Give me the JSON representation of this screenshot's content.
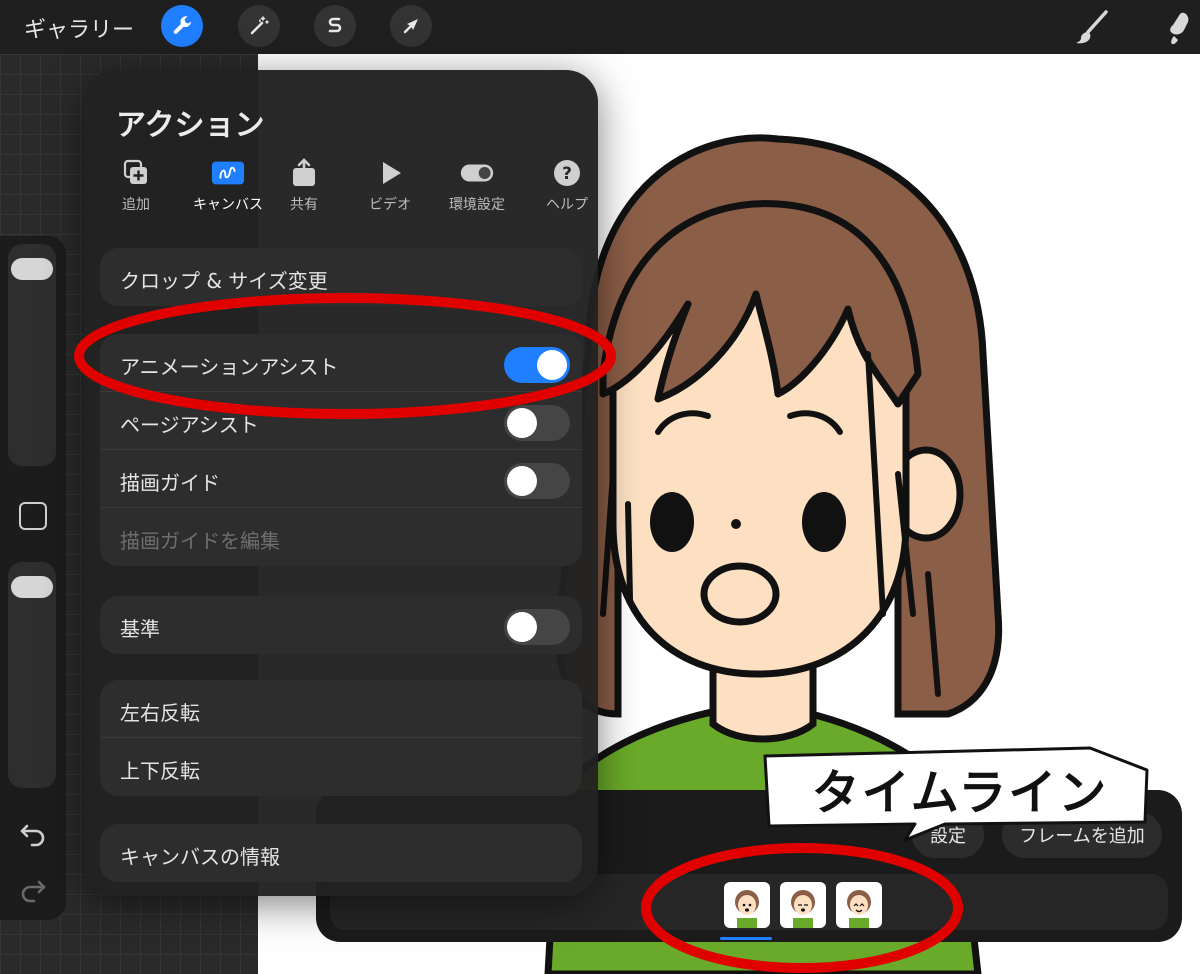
{
  "topbar": {
    "gallery": "ギャラリー",
    "tools": [
      {
        "name": "actions-wrench-icon",
        "active": true
      },
      {
        "name": "adjustments-wand-icon",
        "active": false
      },
      {
        "name": "selection-s-icon",
        "active": false
      },
      {
        "name": "transform-arrow-icon",
        "active": false
      }
    ],
    "right_tools": [
      "brush-icon",
      "smudge-icon"
    ]
  },
  "panel": {
    "title": "アクション",
    "tabs": [
      {
        "label": "追加",
        "icon": "add-icon",
        "active": false
      },
      {
        "label": "キャンバス",
        "icon": "canvas-icon",
        "active": true
      },
      {
        "label": "共有",
        "icon": "share-icon",
        "active": false
      },
      {
        "label": "ビデオ",
        "icon": "video-icon",
        "active": false
      },
      {
        "label": "環境設定",
        "icon": "prefs-toggle-icon",
        "active": false
      },
      {
        "label": "ヘルプ",
        "icon": "help-icon",
        "active": false
      }
    ],
    "crop_resize": "クロップ & サイズ変更",
    "animation_assist": {
      "label": "アニメーションアシスト",
      "on": true
    },
    "page_assist": {
      "label": "ページアシスト",
      "on": false
    },
    "drawing_guide": {
      "label": "描画ガイド",
      "on": false
    },
    "edit_drawing_guide": "描画ガイドを編集",
    "reference": {
      "label": "基準",
      "on": false
    },
    "flip_horizontal": "左右反転",
    "flip_vertical": "上下反転",
    "canvas_info": "キャンバスの情報"
  },
  "timeline": {
    "settings": "設定",
    "add_frame": "フレームを追加",
    "frames": [
      "frame-1",
      "frame-2",
      "frame-3"
    ],
    "selected_frame": 1
  },
  "callout": {
    "text": "タイムライン"
  },
  "colors": {
    "accent": "#1f7fff",
    "annotation_red": "#e00000",
    "hair": "#8b5e47",
    "skin": "#fde0c2",
    "shirt": "#6aaa2a"
  }
}
